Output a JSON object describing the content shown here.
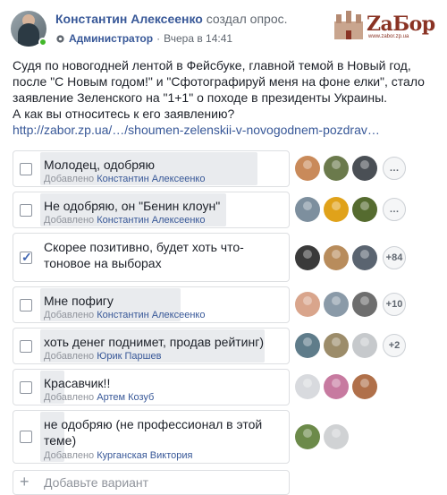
{
  "post": {
    "author_name": "Константин Алексеенко",
    "action": "создал опрос.",
    "role": "Администратор",
    "time": "Вчера в 14:41",
    "text_lines": [
      "Судя по новогодней лентой в Фейсбуке, главной темой в Новый год,",
      "после \"С Новым годом!\" и \"Сфотографируй меня на фоне елки\", стало",
      "заявление Зеленского на \"1+1\" о походе в президенты Украины.",
      "А как вы относитесь к его заявлению?"
    ],
    "link": "http://zabor.zp.ua/…/shoumen-zelenskii-v-novogodnem-pozdrav…"
  },
  "logo": {
    "text": "ZаБор",
    "sub": "www.zabor.zp.ua"
  },
  "added_prefix": "Добавлено",
  "options": [
    {
      "label": "Молодец, одобряю",
      "added_by": "Константин Алексеенко",
      "checked": false,
      "fill": 0.9,
      "more": "…",
      "voter_colors": [
        "#c98a5a",
        "#6b7a4c",
        "#4a4f55"
      ]
    },
    {
      "label": "Не одобряю, он \"Бенин клоун\"",
      "added_by": "Константин Алексеенко",
      "checked": false,
      "fill": 0.77,
      "more": "…",
      "voter_colors": [
        "#7d8f9e",
        "#e0a21a",
        "#556b2f"
      ]
    },
    {
      "label": "Скорее позитивно, будет хоть что-тоновое на выборах",
      "added_by": "",
      "checked": true,
      "fill": 0.0,
      "more": "+84",
      "voter_colors": [
        "#3a3a3a",
        "#b88c5c",
        "#5a6470"
      ]
    },
    {
      "label": "Мне пофигу",
      "added_by": "Константин Алексеенко",
      "checked": false,
      "fill": 0.58,
      "more": "+10",
      "voter_colors": [
        "#d9a58c",
        "#8a9aa8",
        "#6e6e6e"
      ]
    },
    {
      "label": "хоть денег поднимет, продав рейтинг)",
      "added_by": "Юрик Паршев",
      "checked": false,
      "fill": 0.93,
      "more": "+2",
      "voter_colors": [
        "#5f7c8a",
        "#9c8c6a",
        "#c6c9cc"
      ]
    },
    {
      "label": "Красавчик!!",
      "added_by": "Артем Козуб",
      "checked": false,
      "fill": 0.1,
      "more": "",
      "voter_colors": [
        "#d8dade",
        "#c77aa0",
        "#b0704a"
      ]
    },
    {
      "label": "не одобряю (не профессионал в этой теме)",
      "added_by": "Курганская Виктория",
      "checked": false,
      "fill": 0.1,
      "more": "",
      "voter_colors": [
        "#6c8a4a",
        "#d0d2d4"
      ]
    }
  ],
  "add_option_placeholder": "Добавьте вариант"
}
